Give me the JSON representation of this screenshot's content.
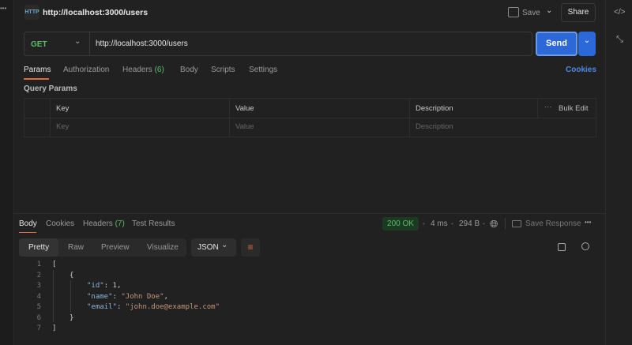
{
  "header": {
    "title": "http://localhost:3000/users",
    "save": "Save",
    "share": "Share"
  },
  "request": {
    "method": "GET",
    "url": "http://localhost:3000/users",
    "send": "Send"
  },
  "req_tabs": [
    {
      "label": "Params"
    },
    {
      "label": "Authorization"
    },
    {
      "label": "Headers",
      "count": "(6)"
    },
    {
      "label": "Body"
    },
    {
      "label": "Scripts"
    },
    {
      "label": "Settings"
    }
  ],
  "cookies": "Cookies",
  "query_params": {
    "title": "Query Params",
    "columns": [
      "Key",
      "Value",
      "Description"
    ],
    "bulk_edit": "Bulk Edit",
    "placeholders": [
      "Key",
      "Value",
      "Description"
    ]
  },
  "resp_tabs": [
    {
      "label": "Body"
    },
    {
      "label": "Cookies"
    },
    {
      "label": "Headers",
      "count": "(7)"
    },
    {
      "label": "Test Results"
    }
  ],
  "status": {
    "code": "200 OK",
    "time": "4 ms",
    "size": "294 B",
    "save_response": "Save Response"
  },
  "view_modes": [
    "Pretty",
    "Raw",
    "Preview",
    "Visualize"
  ],
  "format": "JSON",
  "code_lines": [
    "1",
    "2",
    "3",
    "4",
    "5",
    "6",
    "7"
  ],
  "json": {
    "open": "[",
    "obj_open": "{",
    "id_key": "\"id\"",
    "id_val": "1",
    "name_key": "\"name\"",
    "name_val": "\"John Doe\"",
    "email_key": "\"email\"",
    "email_val": "\"john.doe@example.com\"",
    "obj_close": "}",
    "close": "]"
  },
  "colors": {
    "accent": "#2d68d8",
    "status_bg": "#1c3a22",
    "status_fg": "#5bbf6a",
    "tab_underline": "#e0683a"
  }
}
